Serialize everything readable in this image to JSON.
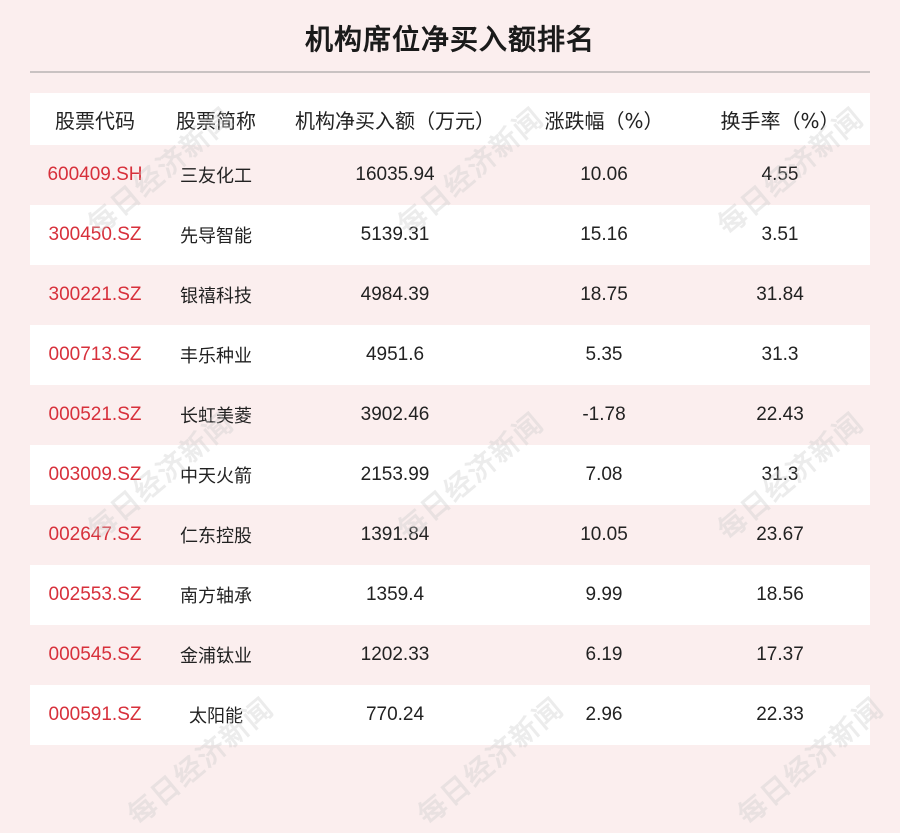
{
  "title": "机构席位净买入额排名",
  "watermark_text": "每日经济新闻",
  "table": {
    "headers": [
      "股票代码",
      "股票简称",
      "机构净买入额（万元）",
      "涨跌幅（%）",
      "换手率（%）"
    ],
    "rows": [
      [
        "600409.SH",
        "三友化工",
        "16035.94",
        "10.06",
        "4.55"
      ],
      [
        "300450.SZ",
        "先导智能",
        "5139.31",
        "15.16",
        "3.51"
      ],
      [
        "300221.SZ",
        "银禧科技",
        "4984.39",
        "18.75",
        "31.84"
      ],
      [
        "000713.SZ",
        "丰乐种业",
        "4951.6",
        "5.35",
        "31.3"
      ],
      [
        "000521.SZ",
        "长虹美菱",
        "3902.46",
        "-1.78",
        "22.43"
      ],
      [
        "003009.SZ",
        "中天火箭",
        "2153.99",
        "7.08",
        "31.3"
      ],
      [
        "002647.SZ",
        "仁东控股",
        "1391.84",
        "10.05",
        "23.67"
      ],
      [
        "002553.SZ",
        "南方轴承",
        "1359.4",
        "9.99",
        "18.56"
      ],
      [
        "000545.SZ",
        "金浦钛业",
        "1202.33",
        "6.19",
        "17.37"
      ],
      [
        "000591.SZ",
        "太阳能",
        "770.24",
        "2.96",
        "22.33"
      ]
    ]
  },
  "colors": {
    "background": "#fbeeee",
    "stock_code": "#d7303b",
    "text": "#222222"
  }
}
